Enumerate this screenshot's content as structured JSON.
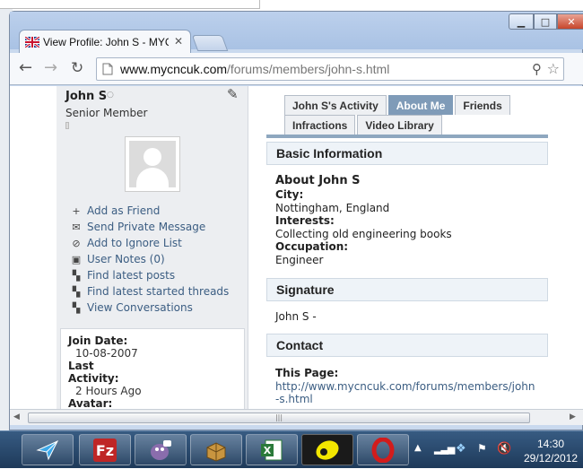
{
  "browser": {
    "tab_title": "View Profile: John S - MYC",
    "tab_close": "✕",
    "url_host": "www.mycncuk.com",
    "url_path": "/forums/members/john-s.html",
    "window_buttons": {
      "minimize": "▁",
      "maximize": "□",
      "close": "✕"
    }
  },
  "profile": {
    "name": "John S",
    "status_icon": "○",
    "title": "Senior Member",
    "actions": [
      {
        "icon": "plus-icon",
        "glyph": "+",
        "label": "Add as Friend"
      },
      {
        "icon": "envelope-icon",
        "glyph": "✉",
        "label": "Send Private Message"
      },
      {
        "icon": "block-icon",
        "glyph": "⊘",
        "label": "Add to Ignore List"
      },
      {
        "icon": "notes-icon",
        "glyph": "▣",
        "label": "User Notes (0)"
      },
      {
        "icon": "posts-icon",
        "glyph": "▚",
        "label": "Find latest posts"
      },
      {
        "icon": "threads-icon",
        "glyph": "▚",
        "label": "Find latest started threads"
      },
      {
        "icon": "conversations-icon",
        "glyph": "▚",
        "label": "View Conversations"
      }
    ],
    "info": {
      "join_label": "Join Date:",
      "join_value": "10-08-2007",
      "activity_label_1": "Last",
      "activity_label_2": "Activity:",
      "activity_value": "2 Hours Ago",
      "avatar_label": "Avatar:"
    }
  },
  "tabs": {
    "row1": [
      {
        "label": "John S's Activity",
        "selected": false
      },
      {
        "label": "About Me",
        "selected": true
      },
      {
        "label": "Friends",
        "selected": false
      }
    ],
    "row2": [
      {
        "label": "Infractions",
        "selected": false
      },
      {
        "label": "Video Library",
        "selected": false
      }
    ]
  },
  "about": {
    "section": "Basic Information",
    "heading": "About John S",
    "city_label": "City:",
    "city": "Nottingham, England",
    "interests_label": "Interests:",
    "interests": "Collecting old engineering books",
    "occupation_label": "Occupation:",
    "occupation": "Engineer"
  },
  "signature": {
    "section": "Signature",
    "text": "John S -"
  },
  "contact": {
    "section": "Contact",
    "label": "This Page:",
    "url": "http://www.mycncuk.com/forums/members/john-s.html"
  },
  "taskbar": {
    "apps": [
      "mail-app-icon",
      "filezilla-icon",
      "pidgin-icon",
      "package-icon",
      "excel-icon",
      "pdf-reader-icon",
      "opera-icon"
    ],
    "time": "14:30",
    "date": "29/12/2012"
  },
  "colors": {
    "link": "#3b5d82",
    "tab_selected": "#7f9bb8",
    "section_bg": "#eef3f8",
    "taskbar": "#1e3a5a"
  }
}
